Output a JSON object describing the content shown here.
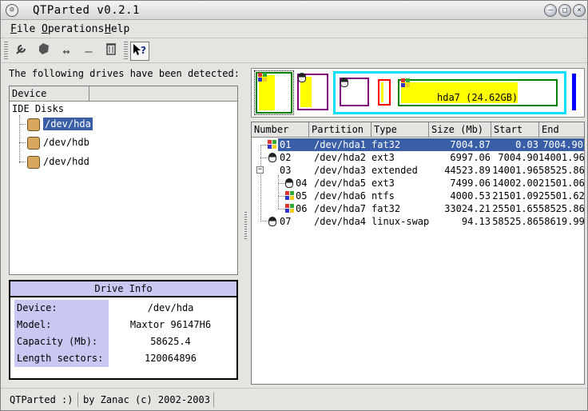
{
  "window": {
    "title": "QTParted v0.2.1",
    "buttons": [
      "minimize",
      "maximize",
      "close"
    ]
  },
  "menu": {
    "items": [
      "File",
      "Operations",
      "Help"
    ]
  },
  "toolbar": {
    "tools": [
      {
        "name": "properties-icon",
        "glyph": "🔧"
      },
      {
        "name": "format-icon",
        "glyph": "⬢"
      },
      {
        "name": "resize-icon",
        "glyph": "↔"
      },
      {
        "name": "delete-icon",
        "glyph": "—"
      },
      {
        "name": "trash-icon",
        "glyph": "🗑"
      },
      {
        "name": "whats-this-icon",
        "glyph": "↖?"
      }
    ]
  },
  "left": {
    "detected_label": "The following drives have been detected:",
    "tree_header": "Device",
    "root": "IDE Disks",
    "drives": [
      {
        "label": "/dev/hda",
        "selected": true
      },
      {
        "label": "/dev/hdb",
        "selected": false
      },
      {
        "label": "/dev/hdd",
        "selected": false
      }
    ]
  },
  "drive_info": {
    "title": "Drive Info",
    "rows": [
      {
        "key": "Device:",
        "value": "/dev/hda"
      },
      {
        "key": "Model:",
        "value": "Maxtor 96147H6"
      },
      {
        "key": "Capacity (Mb):",
        "value": "58625.4"
      },
      {
        "key": "Length sectors:",
        "value": "120064896"
      }
    ]
  },
  "partition_bar": {
    "selected_label": "hda7 (24.62GB)",
    "colors": {
      "fat32": "#ffff00",
      "ext3": "#800080",
      "extended": "#00ffff",
      "ntfs": "#ff0000",
      "linux_swap": "#0000ff",
      "fat32_border": "#008000"
    }
  },
  "partitions": {
    "headers": [
      "Number",
      "Partition",
      "Type",
      "Size (Mb)",
      "Start",
      "End"
    ],
    "rows": [
      {
        "number": "01",
        "partition": "/dev/hda1",
        "type": "fat32",
        "size": "7004.87",
        "start": "0.03",
        "end": "7004.90",
        "icon": "windows",
        "level": 0,
        "selected": true
      },
      {
        "number": "02",
        "partition": "/dev/hda2",
        "type": "ext3",
        "size": "6997.06",
        "start": "7004.90",
        "end": "14001.96",
        "icon": "linux",
        "level": 0,
        "selected": false
      },
      {
        "number": "03",
        "partition": "/dev/hda3",
        "type": "extended",
        "size": "44523.89",
        "start": "14001.96",
        "end": "58525.86",
        "icon": "none",
        "level": 0,
        "selected": false
      },
      {
        "number": "04",
        "partition": "/dev/hda5",
        "type": "ext3",
        "size": "7499.06",
        "start": "14002.00",
        "end": "21501.06",
        "icon": "linux",
        "level": 1,
        "selected": false
      },
      {
        "number": "05",
        "partition": "/dev/hda6",
        "type": "ntfs",
        "size": "4000.53",
        "start": "21501.09",
        "end": "25501.62",
        "icon": "windows",
        "level": 1,
        "selected": false
      },
      {
        "number": "06",
        "partition": "/dev/hda7",
        "type": "fat32",
        "size": "33024.21",
        "start": "25501.65",
        "end": "58525.86",
        "icon": "windows",
        "level": 1,
        "selected": false
      },
      {
        "number": "07",
        "partition": "/dev/hda4",
        "type": "linux-swap",
        "size": "94.13",
        "start": "58525.86",
        "end": "58619.99",
        "icon": "linux",
        "level": 0,
        "selected": false
      }
    ]
  },
  "status": {
    "left": "QTParted :)",
    "right": "by Zanac (c) 2002-2003"
  }
}
